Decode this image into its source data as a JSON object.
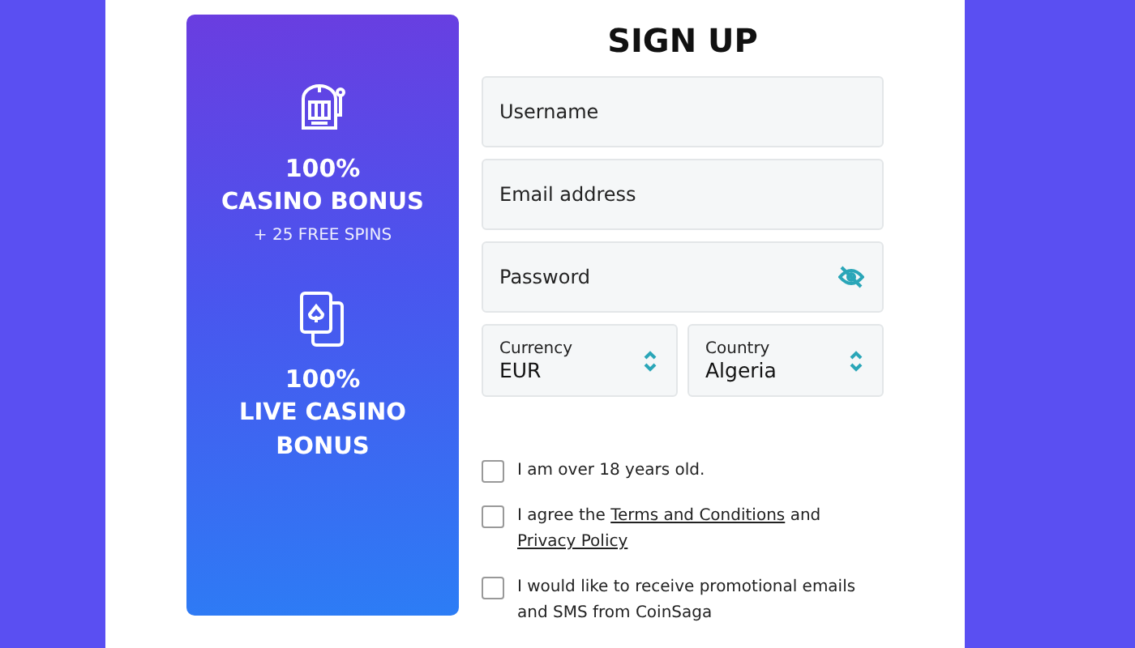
{
  "promo": {
    "bonuses": [
      {
        "kind": "slot",
        "amount": "100%",
        "title": "CASINO BONUS",
        "extra": "+ 25 FREE SPINS"
      },
      {
        "kind": "cards",
        "amount": "100%",
        "title": "LIVE CASINO BONUS"
      }
    ]
  },
  "form": {
    "title": "SIGN UP",
    "fields": [
      {
        "kind": "text",
        "placeholder": "Username"
      },
      {
        "kind": "text",
        "placeholder": "Email address"
      },
      {
        "kind": "password",
        "placeholder": "Password"
      }
    ],
    "selects": [
      {
        "label": "Currency",
        "value": "EUR"
      },
      {
        "label": "Country",
        "value": "Algeria"
      }
    ],
    "checkboxes": [
      {
        "checked": false,
        "parts": [
          {
            "kind": "text",
            "text": "I am over 18 years old."
          }
        ]
      },
      {
        "checked": false,
        "parts": [
          {
            "kind": "text",
            "text": "I agree the "
          },
          {
            "kind": "link",
            "text": "Terms and Conditions"
          },
          {
            "kind": "text",
            "text": " and "
          },
          {
            "kind": "link",
            "text": "Privacy Policy"
          }
        ]
      },
      {
        "checked": false,
        "parts": [
          {
            "kind": "text",
            "text": "I would like to receive promotional emails and SMS from CoinSaga"
          }
        ]
      }
    ]
  }
}
